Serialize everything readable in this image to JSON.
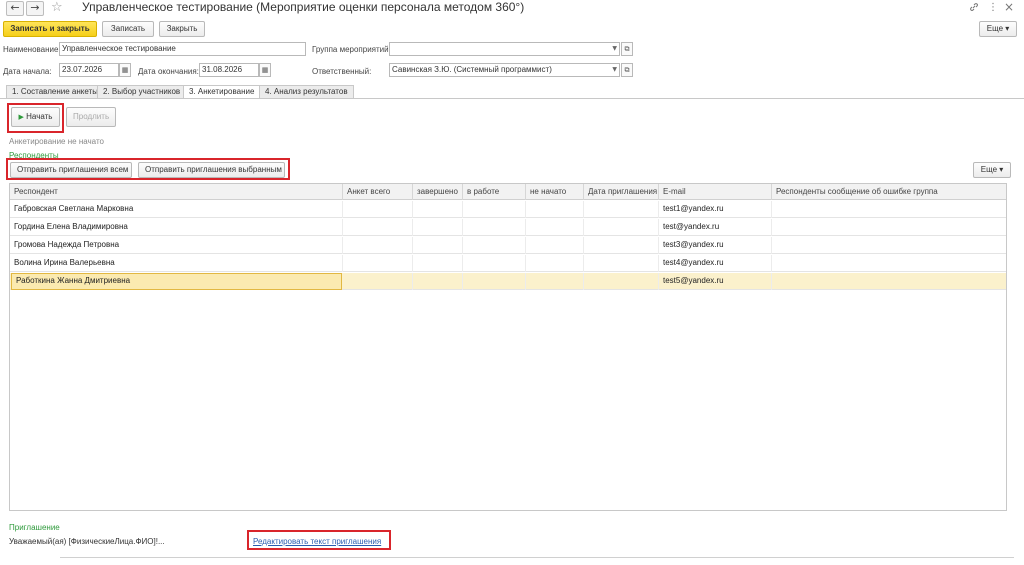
{
  "window": {
    "title": "Управленческое тестирование (Мероприятие оценки персонала методом 360°)",
    "back_icon": "←",
    "forward_icon": "→",
    "star_icon": "☆",
    "link_icon": "🔗",
    "menu_icon": "⋮",
    "close_icon": "×"
  },
  "toolbar": {
    "save_close_label": "Записать и закрыть",
    "save_label": "Записать",
    "close_label": "Закрыть",
    "more_label": "Еще ▾"
  },
  "form": {
    "name_label": "Наименование:",
    "name_value": "Управленческое тестирование",
    "group_label": "Группа мероприятий:",
    "group_value": "",
    "start_label": "Дата начала:",
    "start_value": "23.07.2026",
    "end_label": "Дата окончания:",
    "end_value": "31.08.2026",
    "responsible_label": "Ответственный:",
    "responsible_value": "Савинская З.Ю. (Системный программист)"
  },
  "tabs": [
    {
      "label": "1. Составление анкеты"
    },
    {
      "label": "2. Выбор участников"
    },
    {
      "label": "3. Анкетирование"
    },
    {
      "label": "4. Анализ результатов"
    }
  ],
  "survey": {
    "start_label": "Начать",
    "continue_label": "Продлить",
    "status_text": "Анкетирование не начато",
    "respondents_caption": "Респонденты",
    "send_all_label": "Отправить приглашения всем",
    "send_selected_label": "Отправить приглашения выбранным",
    "more_label": "Еще ▾"
  },
  "table": {
    "columns": [
      "Респондент",
      "Анкет всего",
      "завершено",
      "в работе",
      "не начато",
      "Дата приглашения",
      "E-mail",
      "Респонденты сообщение об ошибке группа"
    ],
    "rows": [
      {
        "name": "Габровская Светлана Марковна",
        "email": "test1@yandex.ru"
      },
      {
        "name": "Гордина Елена Владимировна",
        "email": "test@yandex.ru"
      },
      {
        "name": "Громова Надежда Петровна",
        "email": "test3@yandex.ru"
      },
      {
        "name": "Волина Ирина Валерьевна",
        "email": "test4@yandex.ru"
      },
      {
        "name": "Работкина Жанна Дмитриевна",
        "email": "test5@yandex.ru"
      }
    ]
  },
  "invitation": {
    "caption": "Приглашение",
    "text": "Уважаемый(ая) [ФизическиеЛица.ФИО]!...",
    "edit_link": "Редактировать текст приглашения"
  }
}
